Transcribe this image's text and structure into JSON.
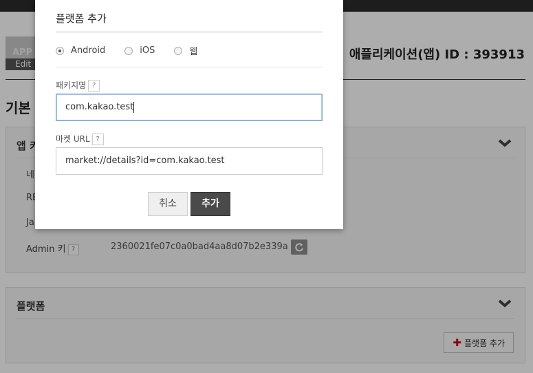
{
  "page": {
    "app_thumb_text": "APP",
    "edit_label": "Edit",
    "app_id_label": "애플리케이션(앱) ID : 393913",
    "section_title": "기본",
    "panel_app": {
      "title": "앱 키",
      "rows": [
        "네",
        "RE",
        "Ja"
      ],
      "admin_label": "Admin 키",
      "admin_value": "2360021fe07c0a0bad4aa8d07b2e339a"
    },
    "panel_platform": {
      "title": "플랫폼",
      "add_button": "플랫폼 추가"
    }
  },
  "modal": {
    "title": "플랫폼 추가",
    "platforms": [
      {
        "label": "Android",
        "selected": true
      },
      {
        "label": "iOS",
        "selected": false
      },
      {
        "label": "웹",
        "selected": false
      }
    ],
    "package_label": "패키지명",
    "package_value": "com.kakao.test",
    "market_label": "마켓 URL",
    "market_value": "market://details?id=com.kakao.test",
    "help_glyph": "?",
    "cancel_label": "취소",
    "add_label": "추가"
  },
  "colors": {
    "primary_button": "#4a4a4a",
    "focus_border": "#7aa7d8",
    "plus_icon": "#cc0000"
  }
}
